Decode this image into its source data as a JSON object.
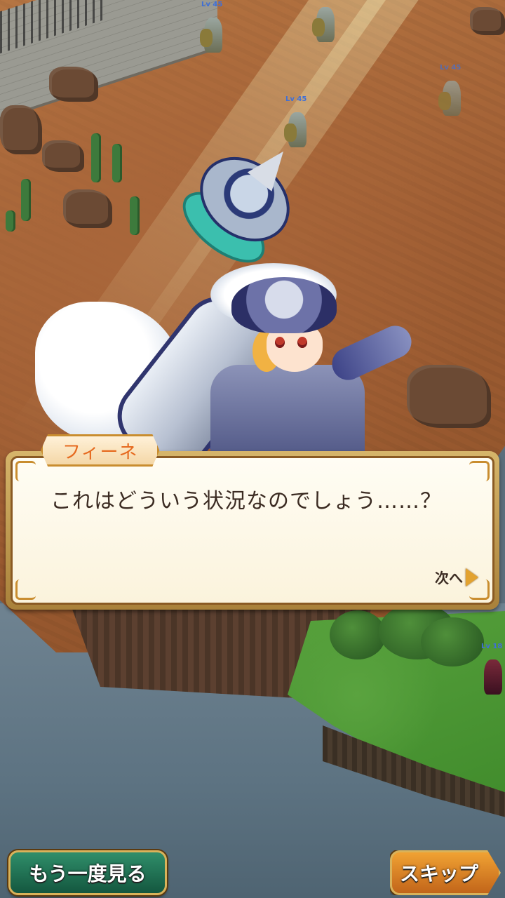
{
  "dialog": {
    "speaker": "フィーネ",
    "text": "これはどういう状況なのでしょう……？",
    "next_label": "次へ"
  },
  "buttons": {
    "replay_label": "もう一度見る",
    "skip_label": "スキップ"
  },
  "units": [
    {
      "level": "Lv 45"
    },
    {
      "level": "Lv 45"
    },
    {
      "level": "Lv 45"
    },
    {
      "level": "Lv 18"
    }
  ],
  "icons": {
    "next": "triangle-right-icon"
  },
  "colors": {
    "speaker_name": "#e66a1f",
    "dialog_border": "#c98d2f",
    "replay_button": "#2f8e6a",
    "skip_button": "#f0a233",
    "level_label": "#3f6fd6"
  }
}
